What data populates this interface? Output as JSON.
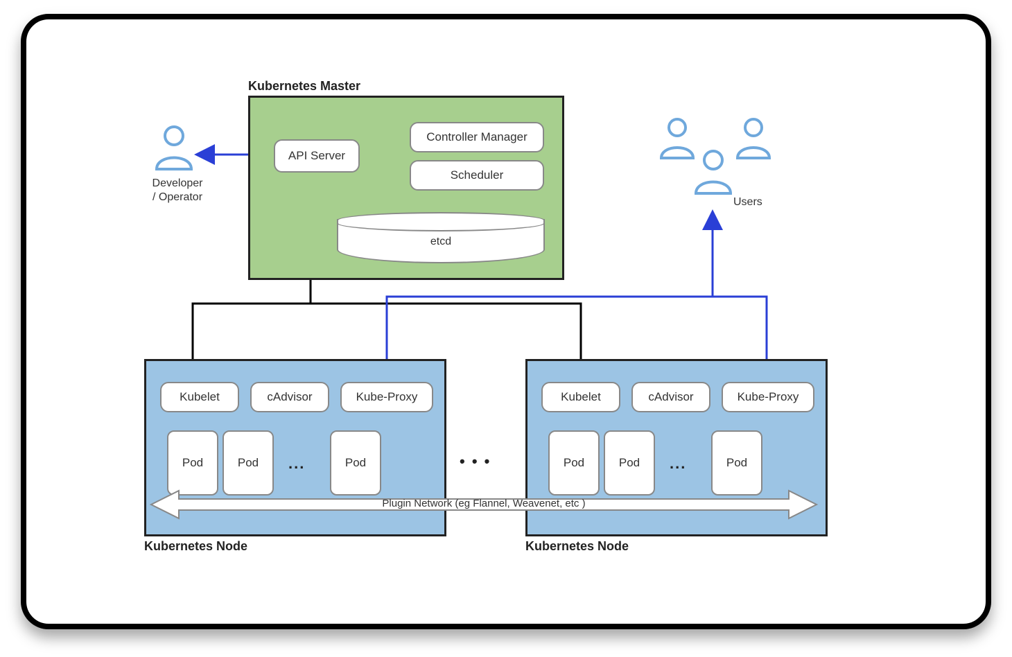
{
  "master": {
    "title": "Kubernetes Master",
    "api": "API Server",
    "controller": "Controller Manager",
    "scheduler": "Scheduler",
    "etcd": "etcd"
  },
  "developer": {
    "label_line1": "Developer",
    "label_line2": "/ Operator"
  },
  "users": {
    "label": "Users"
  },
  "node": {
    "title": "Kubernetes Node",
    "kubelet": "Kubelet",
    "cadvisor": "cAdvisor",
    "kubeproxy": "Kube-Proxy",
    "pod": "Pod",
    "ellipsis": "..."
  },
  "between_ellipsis": "• • •",
  "network_label": "Plugin Network (eg Flannel, Weavenet, etc )",
  "colors": {
    "master_bg": "#a7cf8e",
    "node_bg": "#9cc4e4",
    "blue_stroke": "#2a3fd6",
    "black": "#000000",
    "person_blue": "#6fa8dc"
  }
}
